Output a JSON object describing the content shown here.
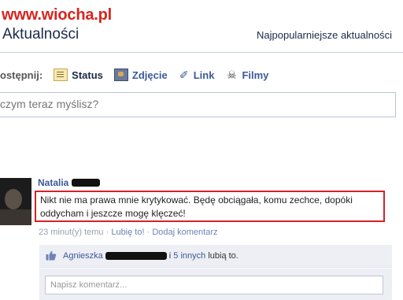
{
  "watermark": "www.wiocha.pl",
  "header": {
    "title": "Aktualności",
    "top_stories": "Najpopularniejsze aktualności"
  },
  "share": {
    "label": "ostępnij:",
    "items": [
      {
        "label": "Status",
        "icon": "status-icon"
      },
      {
        "label": "Zdjęcie",
        "icon": "photo-icon"
      },
      {
        "label": "Link",
        "icon": "link-icon"
      },
      {
        "label": "Filmy",
        "icon": "video-icon"
      }
    ],
    "placeholder": "czym teraz myślisz?"
  },
  "post": {
    "author": "Natalia",
    "text_line1": "Nikt nie ma prawa mnie krytykować. Będę obciągała, komu zechce, dopóki",
    "text_line2": "oddycham i jeszcze mogę klęczeć!",
    "time": "23 minut(y) temu",
    "sep": "·",
    "like_link": "Lubię to!",
    "comment_link": "Dodaj komentarz",
    "likes": {
      "name_start": "Agnieszka",
      "name_end": "i",
      "others_link": "5 innych",
      "suffix": "lubią to."
    },
    "comment_placeholder": "Napisz komentarz..."
  },
  "colors": {
    "link": "#3b5998",
    "highlight_border": "#d5212a",
    "watermark": "#d8241d"
  }
}
